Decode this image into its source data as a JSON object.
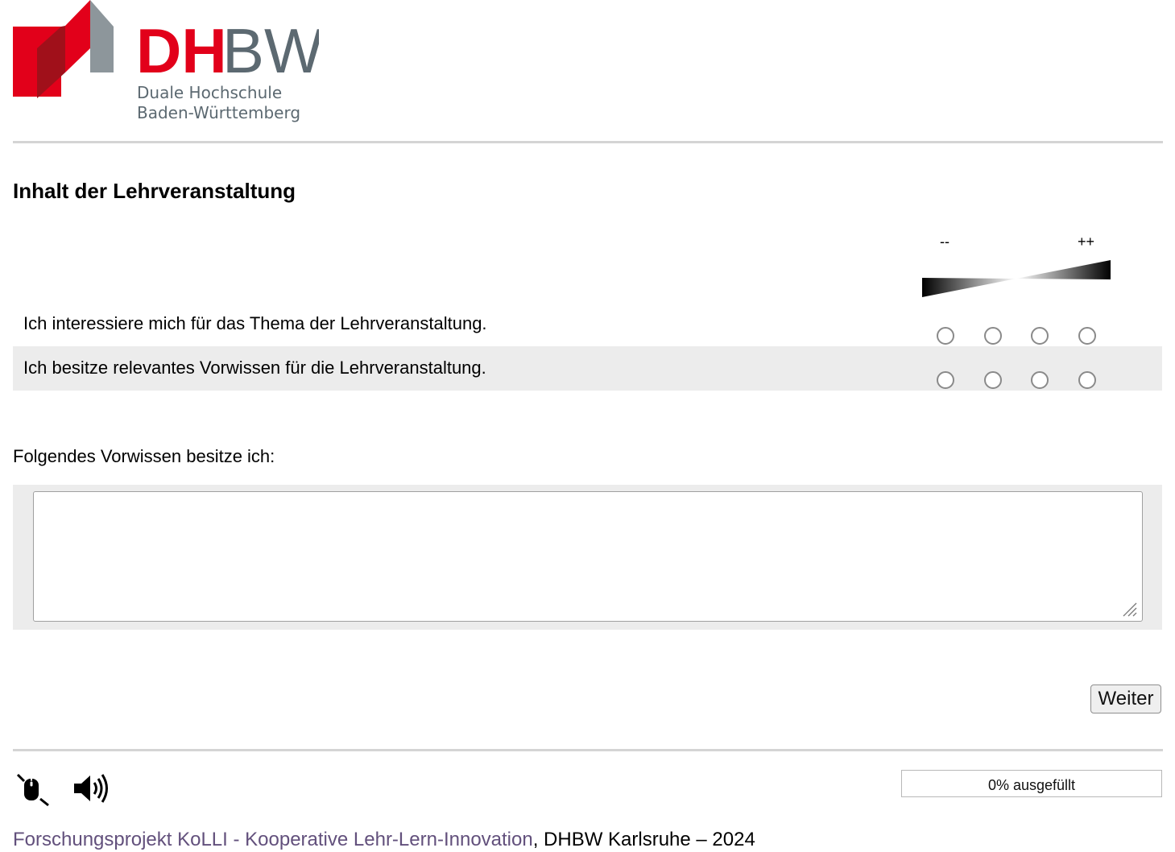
{
  "brand": {
    "wordmark_red": "DH",
    "wordmark_gray": "BW",
    "subtitle_line1": "Duale Hochschule",
    "subtitle_line2": "Baden-Württemberg",
    "colors": {
      "red": "#e2001a",
      "dark_red": "#a0101a",
      "gray": "#5c6971",
      "light_gray": "#8d969b"
    }
  },
  "section": {
    "title": "Inhalt der Lehrveranstaltung"
  },
  "scale": {
    "low_label": "--",
    "high_label": "++",
    "options_count": 4
  },
  "items": [
    {
      "text": "Ich interessiere mich für das Thema der Lehrveranstaltung.",
      "selected": null
    },
    {
      "text": "Ich besitze relevantes Vorwissen für die Lehrveranstaltung.",
      "selected": null
    }
  ],
  "open_question": {
    "label": "Folgendes Vorwissen besitze ich:",
    "value": "",
    "placeholder": ""
  },
  "nav": {
    "next_label": "Weiter"
  },
  "toolbar": {
    "icons": [
      "mouse-magnifier-icon",
      "speaker-icon"
    ]
  },
  "progress": {
    "percent": 0,
    "text": "0% ausgefüllt"
  },
  "footer": {
    "link_text": "Forschungsprojekt KoLLI - Kooperative Lehr-Lern-Innovation",
    "suffix": ", DHBW Karlsruhe – 2024",
    "link_color": "#62507c"
  }
}
